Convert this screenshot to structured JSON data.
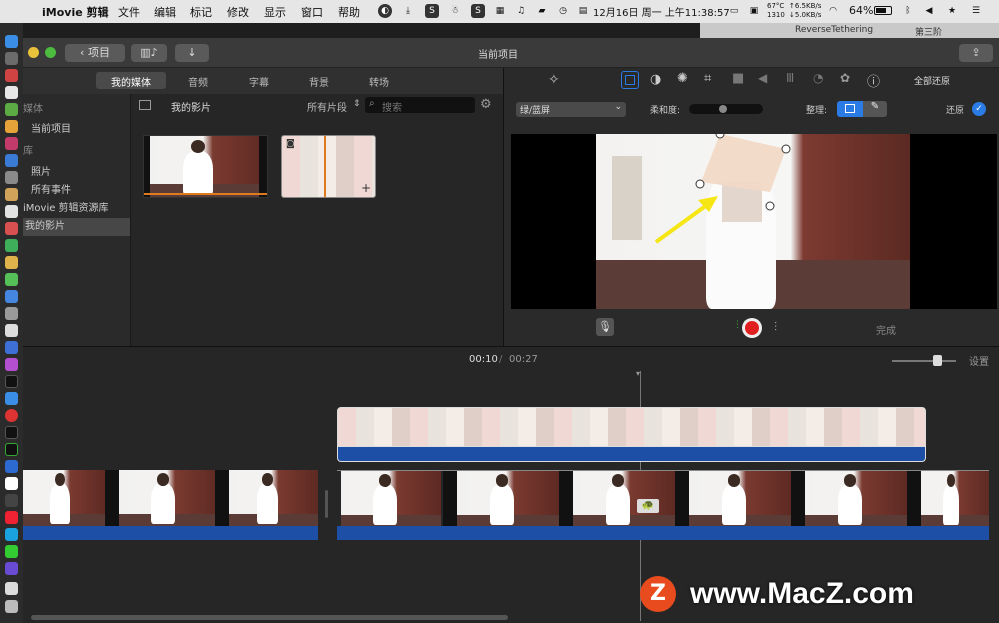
{
  "menubar": {
    "app": "iMovie 剪辑",
    "items": [
      "文件",
      "编辑",
      "标记",
      "修改",
      "显示",
      "窗口",
      "帮助"
    ],
    "clock": "12月16日 周一 上午11:38:57",
    "temp": "67°C",
    "temp2": "1310",
    "net_up": "↑6.5KB/s",
    "net_down": "↓5.0KB/s",
    "battery": "64%"
  },
  "window": {
    "back_label": "项目",
    "title": "当前项目",
    "bg_title1": "ReverseTethering",
    "bg_title2": "第三阶"
  },
  "tabs": [
    "我的媒体",
    "音频",
    "字幕",
    "背景",
    "转场"
  ],
  "sidebar": {
    "section1": "媒体",
    "current_project": "当前项目",
    "section2": "库",
    "photos": "照片",
    "all_events": "所有事件",
    "library": "iMovie 剪辑资源库",
    "my_movies": "我的影片"
  },
  "browser": {
    "title": "我的影片",
    "filter": "所有片段",
    "search_placeholder": "搜索"
  },
  "viewer": {
    "reset_all": "全部还原",
    "effect_select": "绿/蓝屏",
    "softness_label": "柔和度:",
    "cleanup_label": "整理:",
    "restore_label": "还原",
    "done_label": "完成",
    "softness": 0.45
  },
  "timeline": {
    "current_time": "00:10",
    "total_time": "00:27",
    "settings_label": "设置",
    "zoom": 0.75
  },
  "watermark": {
    "text": "www.MacZ.com",
    "logo": "Z"
  },
  "colors": {
    "accent": "#2a7be4",
    "clip_blue": "#1e4fa6",
    "record": "#e02020"
  }
}
